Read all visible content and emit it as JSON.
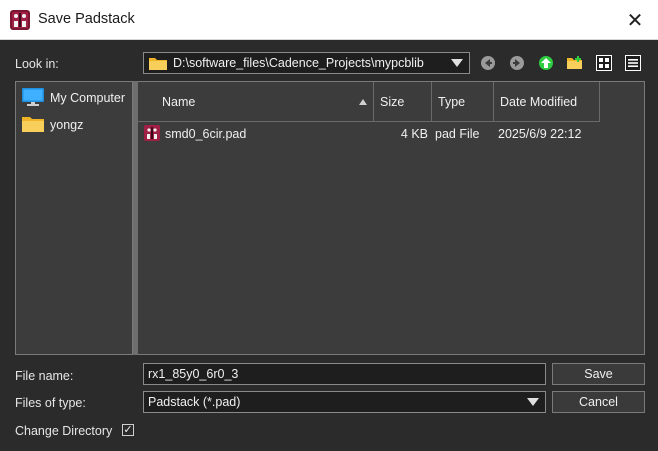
{
  "window": {
    "title": "Save Padstack",
    "close_glyph": "✕"
  },
  "toolbar": {
    "look_in_label": "Look in:",
    "look_in_value": "D:\\software_files\\Cadence_Projects\\mypcblib",
    "buttons": [
      "back-icon",
      "forward-icon",
      "parent-directory-icon",
      "new-folder-icon",
      "list-view-icon",
      "detail-view-icon"
    ]
  },
  "sidebar": {
    "items": [
      {
        "label": "My Computer",
        "icon": "computer-icon"
      },
      {
        "label": "yongz",
        "icon": "folder-icon"
      }
    ]
  },
  "file_list": {
    "columns": [
      "Name",
      "Size",
      "Type",
      "Date Modified"
    ],
    "rows": [
      {
        "name": "smd0_6cir.pad",
        "size": "4 KB",
        "type": "pad File",
        "date": "2025/6/9 22:12"
      }
    ]
  },
  "form": {
    "file_name_label": "File name:",
    "file_name_value": "rx1_85y0_6r0_3",
    "files_of_type_label": "Files of type:",
    "files_of_type_value": "Padstack (*.pad)",
    "change_directory_label": "Change Directory",
    "change_directory_checked": true
  },
  "buttons": {
    "save": "Save",
    "cancel": "Cancel"
  },
  "colors": {
    "background": "#2b2b2b",
    "panel": "#3c3c3c",
    "input": "#1e1e1e",
    "green_arrow": "#2ecc40",
    "folder": "#f5c242",
    "app_icon": "#8b1a3a"
  }
}
